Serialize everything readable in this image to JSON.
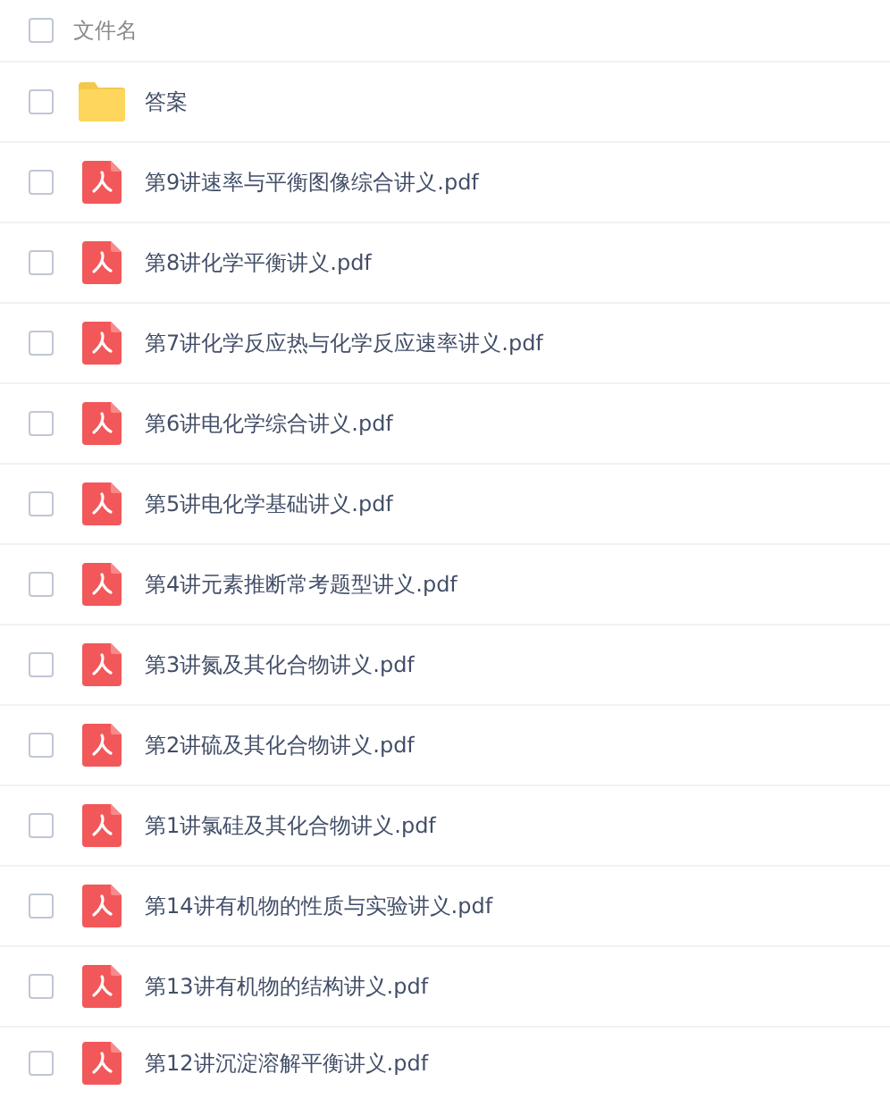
{
  "header": {
    "label": "文件名",
    "checked": false
  },
  "files": [
    {
      "kind": "folder",
      "name": "答案",
      "checked": false
    },
    {
      "kind": "pdf",
      "name": "第9讲速率与平衡图像综合讲义.pdf",
      "checked": false
    },
    {
      "kind": "pdf",
      "name": "第8讲化学平衡讲义.pdf",
      "checked": false
    },
    {
      "kind": "pdf",
      "name": "第7讲化学反应热与化学反应速率讲义.pdf",
      "checked": false
    },
    {
      "kind": "pdf",
      "name": "第6讲电化学综合讲义.pdf",
      "checked": false
    },
    {
      "kind": "pdf",
      "name": "第5讲电化学基础讲义.pdf",
      "checked": false
    },
    {
      "kind": "pdf",
      "name": "第4讲元素推断常考题型讲义.pdf",
      "checked": false
    },
    {
      "kind": "pdf",
      "name": "第3讲氮及其化合物讲义.pdf",
      "checked": false
    },
    {
      "kind": "pdf",
      "name": "第2讲硫及其化合物讲义.pdf",
      "checked": false
    },
    {
      "kind": "pdf",
      "name": "第1讲氯硅及其化合物讲义.pdf",
      "checked": false
    },
    {
      "kind": "pdf",
      "name": "第14讲有机物的性质与实验讲义.pdf",
      "checked": false
    },
    {
      "kind": "pdf",
      "name": "第13讲有机物的结构讲义.pdf",
      "checked": false
    },
    {
      "kind": "pdf",
      "name": "第12讲沉淀溶解平衡讲义.pdf",
      "checked": false
    }
  ]
}
